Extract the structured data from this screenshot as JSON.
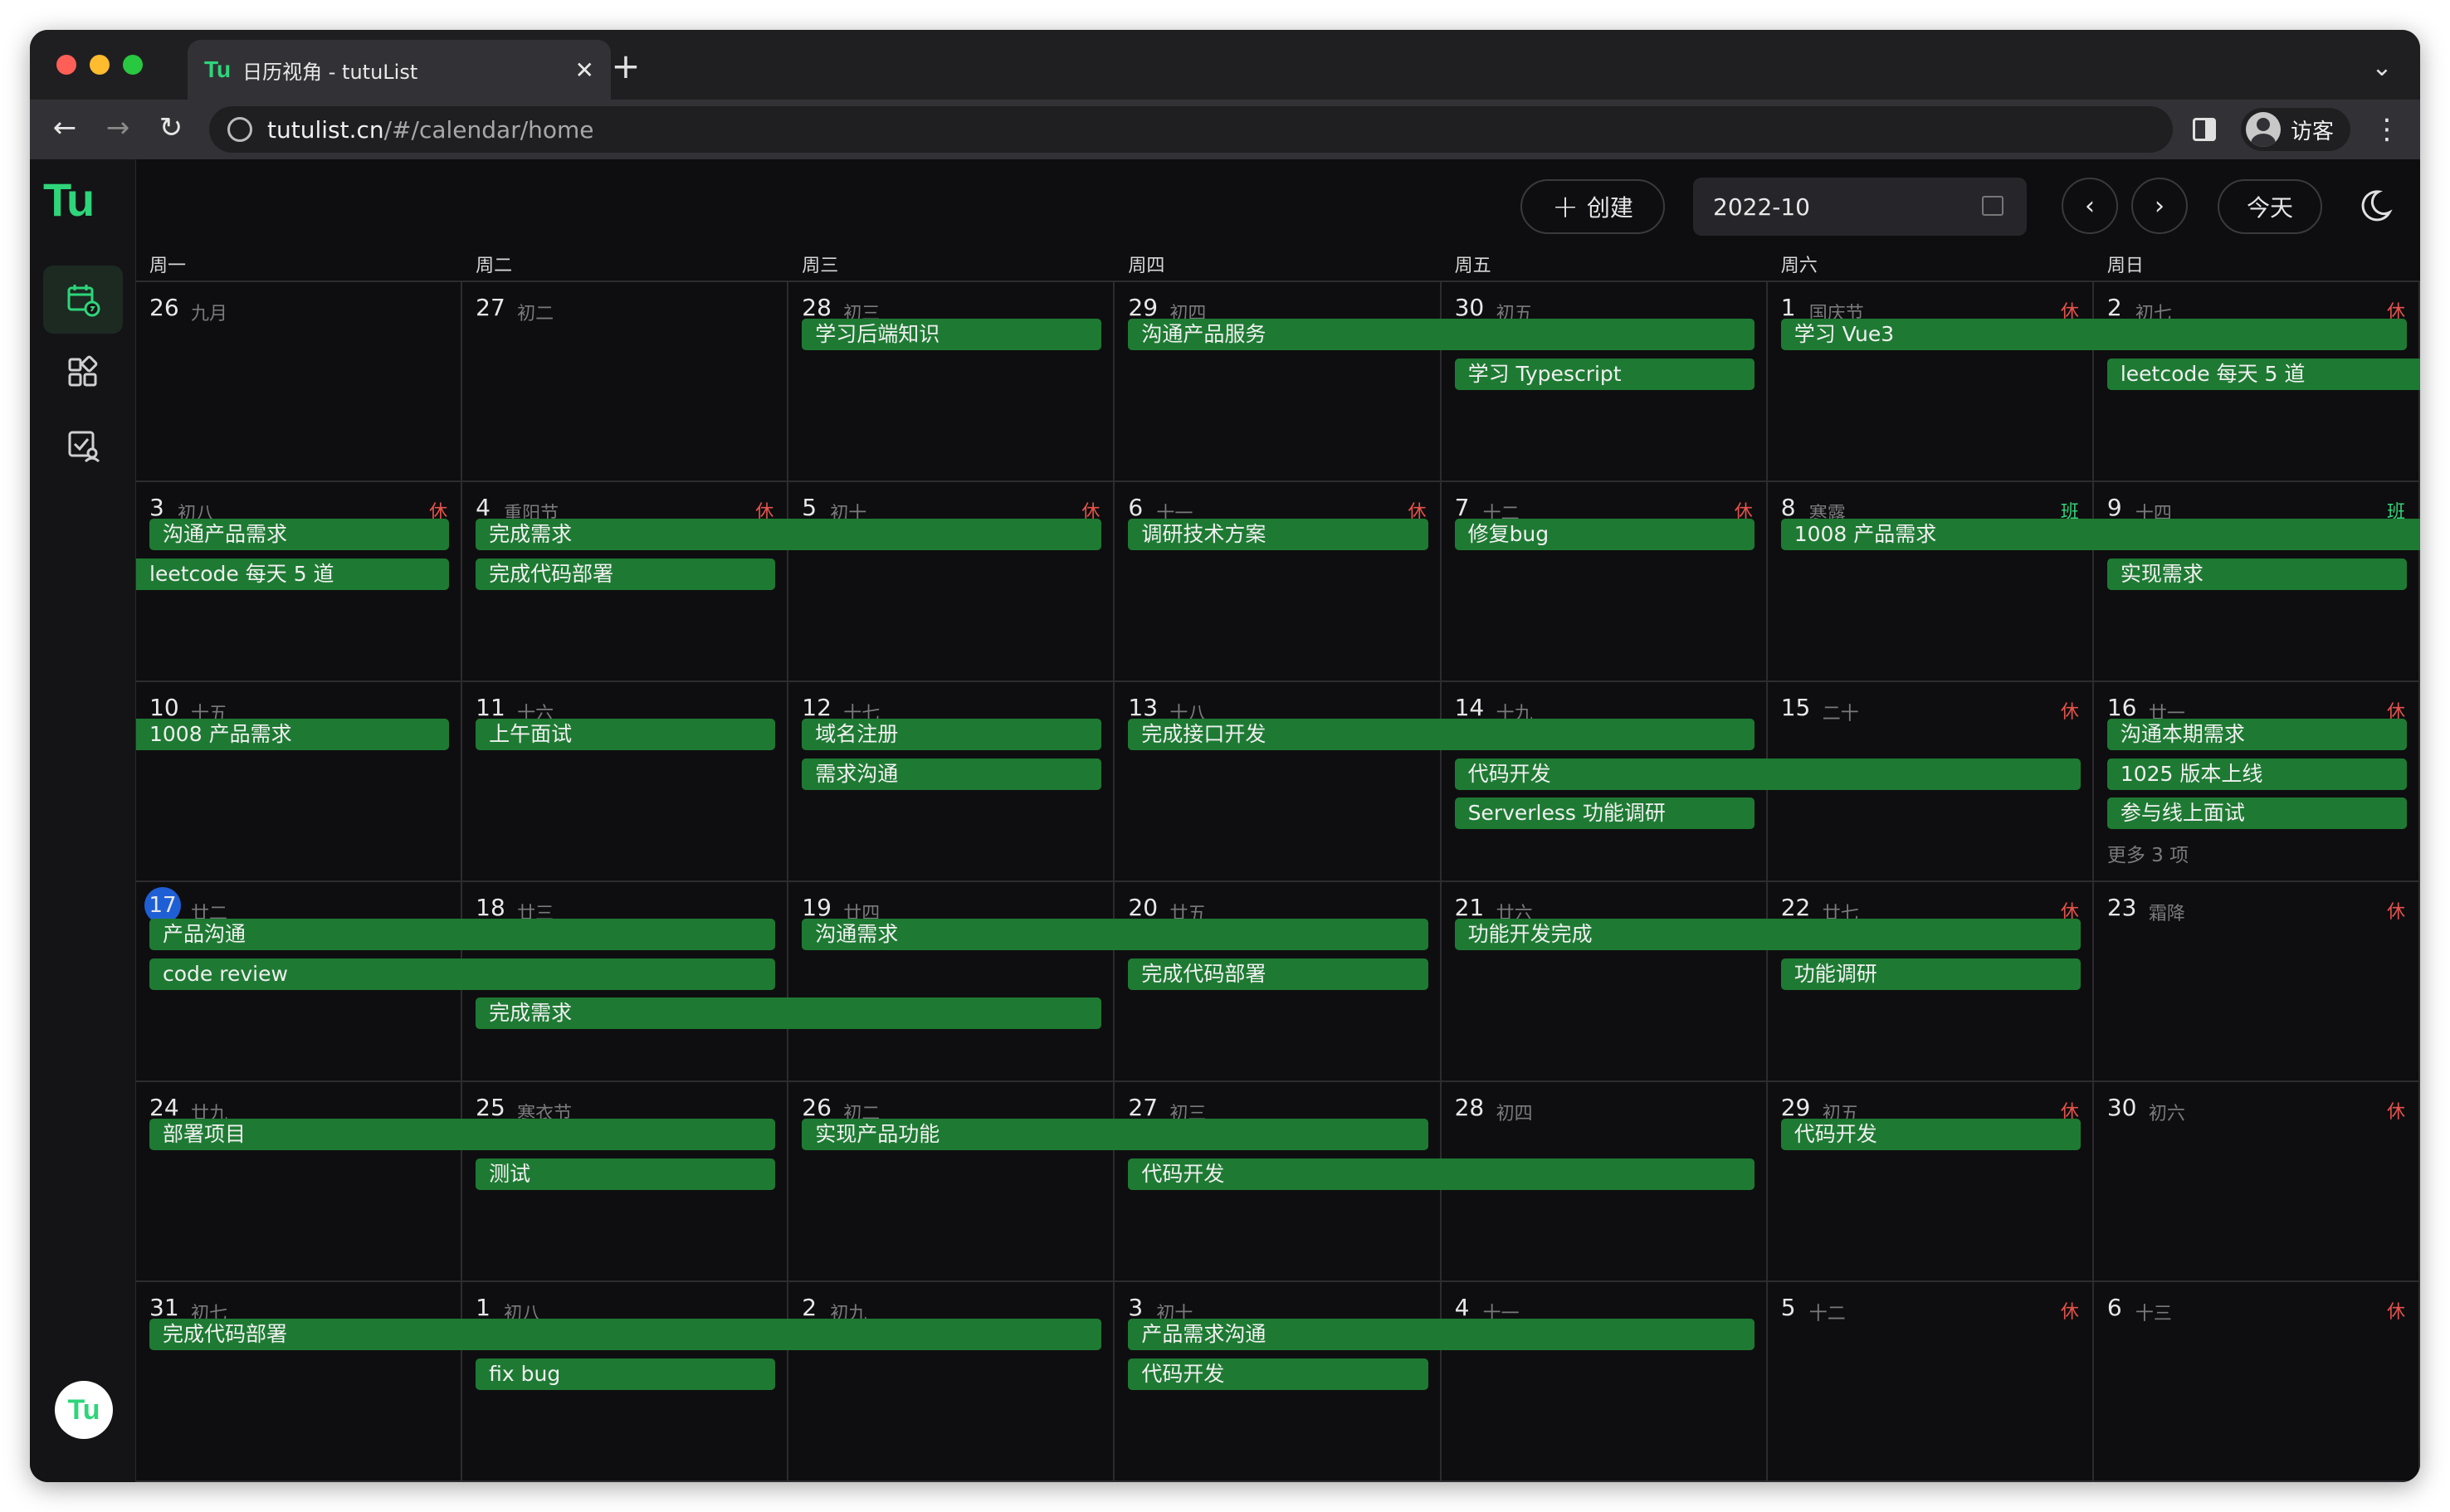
{
  "browser": {
    "tab_title": "日历视角 - tutuList",
    "tab_favicon": "Tu",
    "url_host": "tutulist.cn",
    "url_path": "/#/calendar/home",
    "profile_name": "访客"
  },
  "app": {
    "logo": "Tu",
    "create_label": "创建",
    "month_value": "2022-10",
    "today_label": "今天",
    "avatar_text": "Tu",
    "accent": "#2ed57a",
    "event_color": "#1e7a33",
    "today_color": "#1f5fd6"
  },
  "weekdays": [
    "周一",
    "周二",
    "周三",
    "周四",
    "周五",
    "周六",
    "周日"
  ],
  "weeks": [
    {
      "days": [
        {
          "d": "26",
          "lunar": "九月",
          "badge": "",
          "badge_type": ""
        },
        {
          "d": "27",
          "lunar": "初二",
          "badge": "",
          "badge_type": ""
        },
        {
          "d": "28",
          "lunar": "初三",
          "badge": "",
          "badge_type": ""
        },
        {
          "d": "29",
          "lunar": "初四",
          "badge": "",
          "badge_type": ""
        },
        {
          "d": "30",
          "lunar": "初五",
          "badge": "",
          "badge_type": ""
        },
        {
          "d": "1",
          "lunar": "国庆节",
          "badge": "休",
          "badge_type": "rest"
        },
        {
          "d": "2",
          "lunar": "初七",
          "badge": "休",
          "badge_type": "rest"
        }
      ],
      "events": [
        {
          "title": "学习后端知识",
          "start": 2,
          "span": 1,
          "row": 0
        },
        {
          "title": "沟通产品服务",
          "start": 3,
          "span": 2,
          "row": 0
        },
        {
          "title": "学习 Vue3",
          "start": 5,
          "span": 2,
          "row": 0
        },
        {
          "title": "学习 Typescript",
          "start": 4,
          "span": 1,
          "row": 1
        },
        {
          "title": "leetcode 每天 5 道",
          "start": 6,
          "span": 1,
          "row": 1,
          "continues": true
        }
      ],
      "more": ""
    },
    {
      "days": [
        {
          "d": "3",
          "lunar": "初八",
          "badge": "休",
          "badge_type": "rest"
        },
        {
          "d": "4",
          "lunar": "重阳节",
          "badge": "休",
          "badge_type": "rest"
        },
        {
          "d": "5",
          "lunar": "初十",
          "badge": "休",
          "badge_type": "rest"
        },
        {
          "d": "6",
          "lunar": "十一",
          "badge": "休",
          "badge_type": "rest"
        },
        {
          "d": "7",
          "lunar": "十二",
          "badge": "休",
          "badge_type": "rest"
        },
        {
          "d": "8",
          "lunar": "寒露",
          "badge": "班",
          "badge_type": "work"
        },
        {
          "d": "9",
          "lunar": "十四",
          "badge": "班",
          "badge_type": "work"
        }
      ],
      "events": [
        {
          "title": "沟通产品需求",
          "start": 0,
          "span": 1,
          "row": 0
        },
        {
          "title": "完成需求",
          "start": 1,
          "span": 2,
          "row": 0
        },
        {
          "title": "调研技术方案",
          "start": 3,
          "span": 1,
          "row": 0
        },
        {
          "title": "修复bug",
          "start": 4,
          "span": 1,
          "row": 0
        },
        {
          "title": "1008 产品需求",
          "start": 5,
          "span": 2,
          "row": 0,
          "continues": true
        },
        {
          "title": "leetcode 每天 5 道",
          "start": 0,
          "span": 1,
          "row": 1,
          "continued": true
        },
        {
          "title": "完成代码部署",
          "start": 1,
          "span": 1,
          "row": 1
        },
        {
          "title": "实现需求",
          "start": 6,
          "span": 1,
          "row": 1
        }
      ],
      "more": ""
    },
    {
      "days": [
        {
          "d": "10",
          "lunar": "十五",
          "badge": "",
          "badge_type": ""
        },
        {
          "d": "11",
          "lunar": "十六",
          "badge": "",
          "badge_type": ""
        },
        {
          "d": "12",
          "lunar": "十七",
          "badge": "",
          "badge_type": ""
        },
        {
          "d": "13",
          "lunar": "十八",
          "badge": "",
          "badge_type": ""
        },
        {
          "d": "14",
          "lunar": "十九",
          "badge": "",
          "badge_type": ""
        },
        {
          "d": "15",
          "lunar": "二十",
          "badge": "休",
          "badge_type": "rest"
        },
        {
          "d": "16",
          "lunar": "廿一",
          "badge": "休",
          "badge_type": "rest"
        }
      ],
      "events": [
        {
          "title": "1008 产品需求",
          "start": 0,
          "span": 1,
          "row": 0,
          "continued": true
        },
        {
          "title": "上午面试",
          "start": 1,
          "span": 1,
          "row": 0
        },
        {
          "title": "域名注册",
          "start": 2,
          "span": 1,
          "row": 0
        },
        {
          "title": "完成接口开发",
          "start": 3,
          "span": 2,
          "row": 0
        },
        {
          "title": "沟通本期需求",
          "start": 6,
          "span": 1,
          "row": 0
        },
        {
          "title": "需求沟通",
          "start": 2,
          "span": 1,
          "row": 1
        },
        {
          "title": "代码开发",
          "start": 4,
          "span": 2,
          "row": 1
        },
        {
          "title": "1025 版本上线",
          "start": 6,
          "span": 1,
          "row": 1
        },
        {
          "title": "Serverless 功能调研",
          "start": 4,
          "span": 1,
          "row": 2
        },
        {
          "title": "参与线上面试",
          "start": 6,
          "span": 1,
          "row": 2
        }
      ],
      "more": "更多 3 项"
    },
    {
      "days": [
        {
          "d": "17",
          "lunar": "廿二",
          "badge": "",
          "badge_type": "",
          "today": true
        },
        {
          "d": "18",
          "lunar": "廿三",
          "badge": "",
          "badge_type": ""
        },
        {
          "d": "19",
          "lunar": "廿四",
          "badge": "",
          "badge_type": ""
        },
        {
          "d": "20",
          "lunar": "廿五",
          "badge": "",
          "badge_type": ""
        },
        {
          "d": "21",
          "lunar": "廿六",
          "badge": "",
          "badge_type": ""
        },
        {
          "d": "22",
          "lunar": "廿七",
          "badge": "休",
          "badge_type": "rest"
        },
        {
          "d": "23",
          "lunar": "霜降",
          "badge": "休",
          "badge_type": "rest"
        }
      ],
      "events": [
        {
          "title": "产品沟通",
          "start": 0,
          "span": 2,
          "row": 0
        },
        {
          "title": "沟通需求",
          "start": 2,
          "span": 2,
          "row": 0
        },
        {
          "title": "功能开发完成",
          "start": 4,
          "span": 2,
          "row": 0
        },
        {
          "title": "code review",
          "start": 0,
          "span": 2,
          "row": 1
        },
        {
          "title": "完成代码部署",
          "start": 3,
          "span": 1,
          "row": 1
        },
        {
          "title": "功能调研",
          "start": 5,
          "span": 1,
          "row": 1
        },
        {
          "title": "完成需求",
          "start": 1,
          "span": 2,
          "row": 2
        }
      ],
      "more": ""
    },
    {
      "days": [
        {
          "d": "24",
          "lunar": "廿九",
          "badge": "",
          "badge_type": ""
        },
        {
          "d": "25",
          "lunar": "寒衣节",
          "badge": "",
          "badge_type": ""
        },
        {
          "d": "26",
          "lunar": "初二",
          "badge": "",
          "badge_type": ""
        },
        {
          "d": "27",
          "lunar": "初三",
          "badge": "",
          "badge_type": ""
        },
        {
          "d": "28",
          "lunar": "初四",
          "badge": "",
          "badge_type": ""
        },
        {
          "d": "29",
          "lunar": "初五",
          "badge": "休",
          "badge_type": "rest"
        },
        {
          "d": "30",
          "lunar": "初六",
          "badge": "休",
          "badge_type": "rest"
        }
      ],
      "events": [
        {
          "title": "部署项目",
          "start": 0,
          "span": 2,
          "row": 0
        },
        {
          "title": "实现产品功能",
          "start": 2,
          "span": 2,
          "row": 0
        },
        {
          "title": "代码开发",
          "start": 5,
          "span": 1,
          "row": 0
        },
        {
          "title": "测试",
          "start": 1,
          "span": 1,
          "row": 1
        },
        {
          "title": "代码开发",
          "start": 3,
          "span": 2,
          "row": 1
        }
      ],
      "more": ""
    },
    {
      "days": [
        {
          "d": "31",
          "lunar": "初七",
          "badge": "",
          "badge_type": ""
        },
        {
          "d": "1",
          "lunar": "初八",
          "badge": "",
          "badge_type": ""
        },
        {
          "d": "2",
          "lunar": "初九",
          "badge": "",
          "badge_type": ""
        },
        {
          "d": "3",
          "lunar": "初十",
          "badge": "",
          "badge_type": ""
        },
        {
          "d": "4",
          "lunar": "十一",
          "badge": "",
          "badge_type": ""
        },
        {
          "d": "5",
          "lunar": "十二",
          "badge": "休",
          "badge_type": "rest"
        },
        {
          "d": "6",
          "lunar": "十三",
          "badge": "休",
          "badge_type": "rest"
        }
      ],
      "events": [
        {
          "title": "完成代码部署",
          "start": 0,
          "span": 3,
          "row": 0
        },
        {
          "title": "产品需求沟通",
          "start": 3,
          "span": 2,
          "row": 0
        },
        {
          "title": "fix bug",
          "start": 1,
          "span": 1,
          "row": 1
        },
        {
          "title": "代码开发",
          "start": 3,
          "span": 1,
          "row": 1
        }
      ],
      "more": ""
    }
  ]
}
